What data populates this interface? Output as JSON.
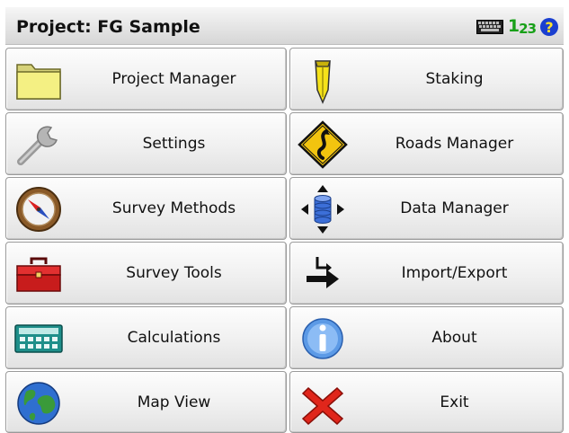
{
  "header": {
    "title": "Project: FG Sample",
    "num_icon_main": "1",
    "num_icon_sub1": "2",
    "num_icon_sub2": "3",
    "help_label": "?"
  },
  "menu": [
    {
      "label": "Project Manager",
      "icon": "folder-icon"
    },
    {
      "label": "Staking",
      "icon": "stake-icon"
    },
    {
      "label": "Settings",
      "icon": "wrench-icon"
    },
    {
      "label": "Roads Manager",
      "icon": "road-sign-icon"
    },
    {
      "label": "Survey Methods",
      "icon": "compass-icon"
    },
    {
      "label": "Data Manager",
      "icon": "database-arrows-icon"
    },
    {
      "label": "Survey Tools",
      "icon": "toolbox-icon"
    },
    {
      "label": "Import/Export",
      "icon": "import-export-icon"
    },
    {
      "label": "Calculations",
      "icon": "calculator-icon"
    },
    {
      "label": "About",
      "icon": "info-icon"
    },
    {
      "label": "Map View",
      "icon": "globe-icon"
    },
    {
      "label": "Exit",
      "icon": "exit-x-icon"
    }
  ],
  "colors": {
    "title_bar": "#d6d6d6",
    "help_icon": "#1a3fd0",
    "numeric_icon": "#18a018",
    "exit_icon": "#e0261b"
  }
}
